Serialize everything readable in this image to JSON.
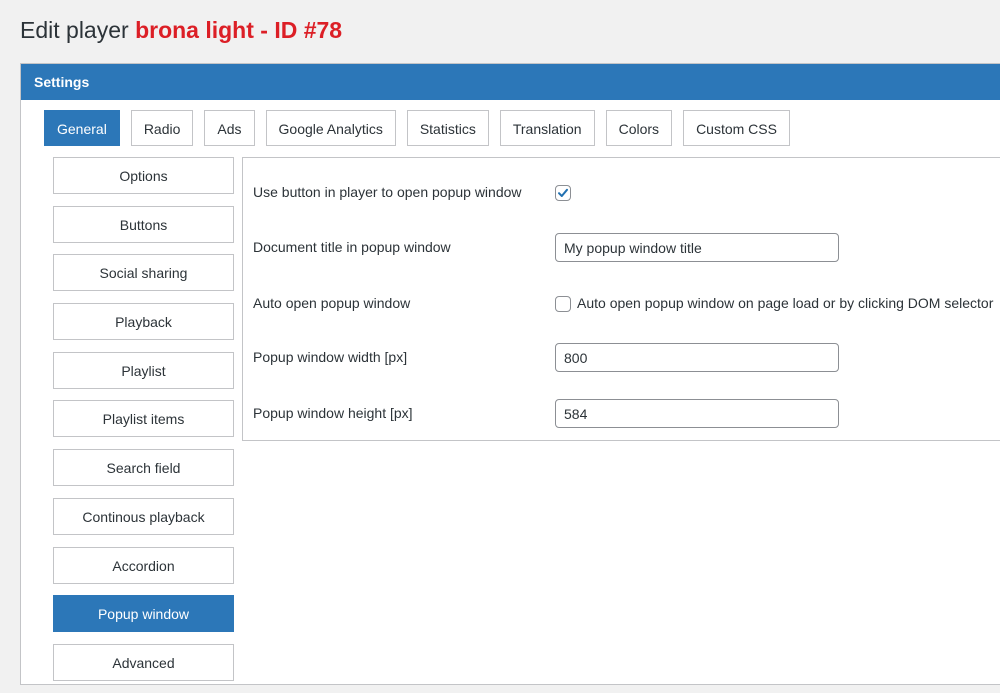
{
  "page": {
    "title_prefix": "Edit player ",
    "title_highlight": "brona light - ID #78"
  },
  "panel": {
    "header": "Settings"
  },
  "tabs": [
    {
      "label": "General",
      "active": true
    },
    {
      "label": "Radio"
    },
    {
      "label": "Ads"
    },
    {
      "label": "Google Analytics"
    },
    {
      "label": "Statistics"
    },
    {
      "label": "Translation"
    },
    {
      "label": "Colors"
    },
    {
      "label": "Custom CSS"
    }
  ],
  "subnav": [
    {
      "label": "Options"
    },
    {
      "label": "Buttons"
    },
    {
      "label": "Social sharing"
    },
    {
      "label": "Playback"
    },
    {
      "label": "Playlist"
    },
    {
      "label": "Playlist items"
    },
    {
      "label": "Search field"
    },
    {
      "label": "Continous playback"
    },
    {
      "label": "Accordion"
    },
    {
      "label": "Popup window",
      "active": true
    },
    {
      "label": "Advanced"
    }
  ],
  "form": {
    "use_button": {
      "label": "Use button in player to open popup window",
      "checked": true
    },
    "doc_title": {
      "label": "Document title in popup window",
      "value": "My popup window title"
    },
    "auto_open": {
      "label": "Auto open popup window",
      "checkbox_label": "Auto open popup window on page load or by clicking DOM selector",
      "checked": false
    },
    "width": {
      "label": "Popup window width [px]",
      "value": "800"
    },
    "height": {
      "label": "Popup window height [px]",
      "value": "584"
    }
  },
  "colors": {
    "accent": "#2c77b8",
    "title_highlight": "#dc1f26",
    "checkmark": "#2271b1"
  }
}
